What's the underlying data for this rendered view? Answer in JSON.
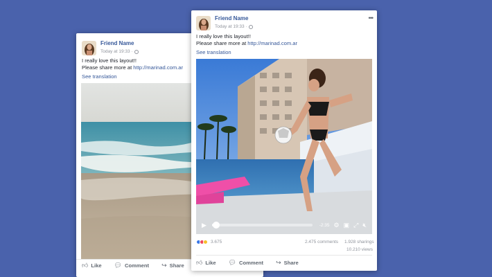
{
  "colors": {
    "background": "#4a62ac",
    "link": "#365899",
    "muted": "#90949c"
  },
  "back_post": {
    "author": "Friend Name",
    "timestamp": "Today at 19:33 ·",
    "text_line1": "I really love this layout!!",
    "text_line2_prefix": "Please share more at ",
    "link": "http://marinad.com.ar",
    "see_translation": "See translation",
    "actions": {
      "like": "Like",
      "comment": "Comment",
      "share": "Share"
    }
  },
  "front_post": {
    "author": "Friend Name",
    "timestamp": "Today at 19:33 ·",
    "menu_icon": "more-dots-icon",
    "text_line1": "I really love this layout!!",
    "text_line2_prefix": "Please share more at ",
    "link": "http://marinad.com.ar",
    "see_translation": "See translation",
    "video": {
      "time_left": "-2:35",
      "progress": 0.04,
      "icons": [
        "play-icon",
        "settings-icon",
        "pip-icon",
        "fullscreen-icon",
        "mute-icon"
      ]
    },
    "reaction_count": "3.675",
    "comments": "2.475 comments",
    "sharings": "1.928 sharings",
    "views": "10.210 views",
    "actions": {
      "like": "Like",
      "comment": "Comment",
      "share": "Share"
    }
  }
}
